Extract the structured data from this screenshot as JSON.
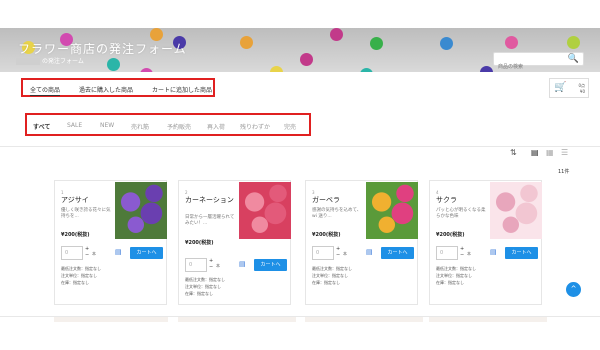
{
  "banner": {
    "title": "フラワー商店の発注フォーム",
    "subtitle": "の発注フォーム",
    "dot_colors": [
      "#e8d34a",
      "#d24bb0",
      "#2bb5a8",
      "#4a3aa8",
      "#e8a23a",
      "#c23a8a",
      "#38b04a",
      "#3a8ad0",
      "#e05aa0",
      "#b0d040"
    ]
  },
  "search": {
    "placeholder": "商品の検索"
  },
  "tabs": [
    {
      "label": "全ての商品",
      "active": true
    },
    {
      "label": "過去に購入した商品",
      "active": false
    },
    {
      "label": "カートに追加した商品",
      "active": false
    }
  ],
  "cart": {
    "line1": "0点",
    "line2": "¥0"
  },
  "filters": [
    {
      "label": "すべて",
      "active": true
    },
    {
      "label": "SALE"
    },
    {
      "label": "NEW"
    },
    {
      "label": "売れ筋"
    },
    {
      "label": "予約販売"
    },
    {
      "label": "再入荷"
    },
    {
      "label": "残りわずか"
    },
    {
      "label": "完売"
    }
  ],
  "view": {
    "sort_icon": "⇅",
    "list_icon": "▤",
    "grid_icon": "▦",
    "lines_icon": "☰"
  },
  "item_count": "11件",
  "products": [
    {
      "num": "1",
      "name": "アジサイ",
      "desc": "優しく咲き誇る花々に気持ちを...",
      "price": "¥200(税抜)",
      "qty": "0",
      "unit": "本",
      "cart_label": "カートへ",
      "meta": [
        "最低注文数：指定なし",
        "注文単位：指定なし",
        "在庫：指定なし"
      ],
      "img_colors": [
        "#6a3fb0",
        "#8a5ad0",
        "#4e7a3a"
      ]
    },
    {
      "num": "2",
      "name": "カーネーション",
      "desc": "日常から一層活躍られてみたい！...",
      "price": "¥200(税抜)",
      "qty": "0",
      "unit": "本",
      "cart_label": "カートへ",
      "meta": [
        "最低注文数：指定なし",
        "注文単位：指定なし",
        "在庫：指定なし"
      ],
      "img_colors": [
        "#e35a7a",
        "#f08aa0",
        "#d84060"
      ]
    },
    {
      "num": "3",
      "name": "ガーベラ",
      "desc": "感謝の気持ちを込めて、wi 送り...",
      "price": "¥200(税抜)",
      "qty": "0",
      "unit": "本",
      "cart_label": "カートへ",
      "meta": [
        "最低注文数：指定なし",
        "注文単位：指定なし",
        "在庫：指定なし"
      ],
      "img_colors": [
        "#e04080",
        "#f0b030",
        "#5a9a3a"
      ]
    },
    {
      "num": "4",
      "name": "サクラ",
      "desc": "パッと心が明るくなる柔らかな色味",
      "price": "¥200(税抜)",
      "qty": "0",
      "unit": "本",
      "cart_label": "カートへ",
      "meta": [
        "最低注文数：指定なし",
        "注文単位：指定なし",
        "在庫：指定なし"
      ],
      "img_colors": [
        "#f2c6d2",
        "#e8a6bc",
        "#fae4ea"
      ]
    }
  ],
  "scroll_top": "^"
}
